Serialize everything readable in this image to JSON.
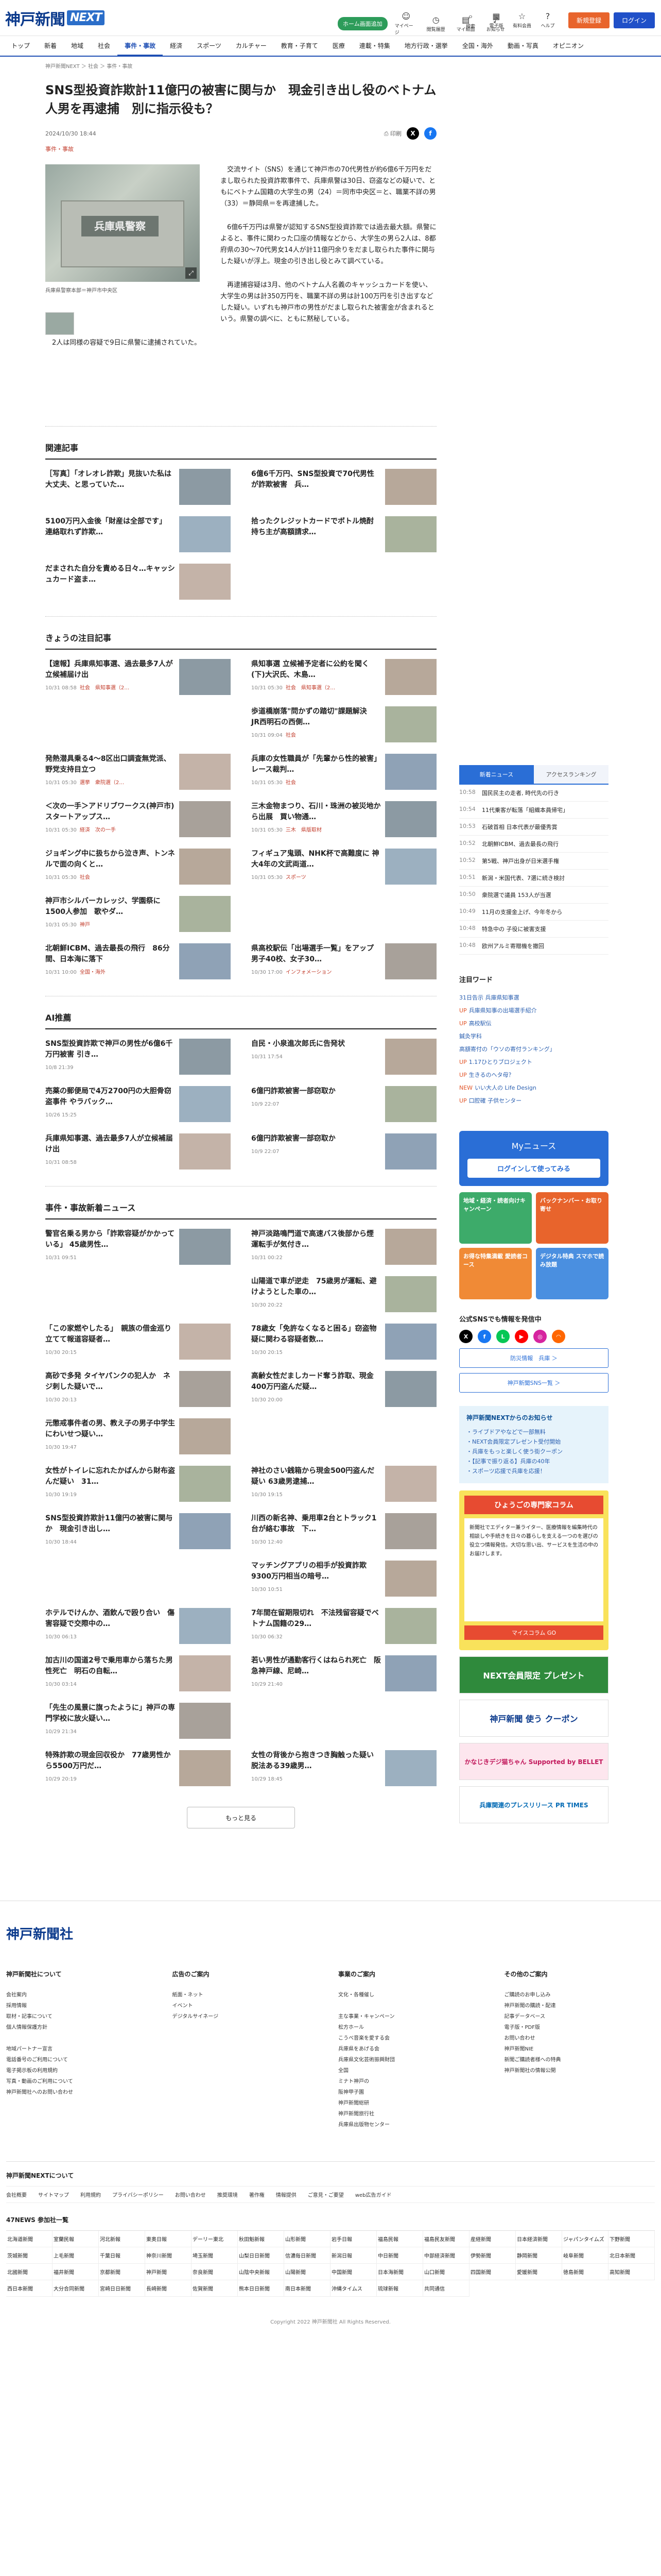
{
  "header": {
    "logo_text": "神戸新聞",
    "logo_next": "NEXT",
    "pill": "ホーム画面追加",
    "icons": [
      "マイページ",
      "閲覧履歴",
      "マイ紙面",
      "お知らせ"
    ],
    "icons2": [
      "検索",
      "電子版",
      "有料会員",
      "ヘルプ"
    ],
    "signup": "新規登録",
    "login": "ログイン"
  },
  "gnav": [
    "トップ",
    "新着",
    "地域",
    "社会",
    "事件・事故",
    "経済",
    "スポーツ",
    "カルチャー",
    "教育・子育て",
    "医療",
    "連載・特集",
    "地方行政・選挙",
    "全国・海外",
    "動画・写真",
    "オピニオン"
  ],
  "gnav_active": 4,
  "breadcrumb": "神戸新聞NEXT ＞ 社会 ＞ 事件・事故",
  "article": {
    "title": "SNS型投資詐欺計11億円の被害に関与か　現金引き出し役のベトナム人男を再逮捕　別に指示役も？",
    "date": "2024/10/30 18:44",
    "print": "印刷",
    "category": "事件・事故",
    "photo_sign": "兵庫県警察",
    "caption": "兵庫県警察本部＝神戸市中央区",
    "paragraphs": [
      "交流サイト（SNS）を通じて神戸市の70代男性が約6億6千万円をだまし取られた投資詐欺事件で、兵庫県警は30日、窃盗などの疑いで、ともにベトナム国籍の大学生の男（24）＝同市中央区＝と、職業不詳の男（33）＝静岡県＝を再逮捕した。",
      "6億6千万円は県警が認知するSNS型投資詐欺では過去最大額。県警によると、事件に関わった口座の情報などから、大学生の男ら2人は、8都府県の30～70代男女14人が計11億円余りをだまし取られた事件に関与した疑いが浮上。現金の引き出し役とみて調べている。",
      "再逮捕容疑は3月、他のベトナム人名義のキャッシュカードを使い、大学生の男は計350万円を、職業不詳の男は計100万円を引き出すなどした疑い。いずれも神戸市の男性がだまし取られた被害金が含まれるという。県警の調べに、ともに黙秘している。",
      "2人は同様の容疑で9日に県警に逮捕されていた。"
    ]
  },
  "related": {
    "heading": "関連記事",
    "items": [
      {
        "title": "［写真］「オレオレ詐欺」見抜いた私は大丈夫、と思っていた…"
      },
      {
        "title": "6億6千万円、SNS型投資で70代男性が詐欺被害　兵…"
      },
      {
        "title": "5100万円入金後「財産は全部です」　連絡取れず詐欺…"
      },
      {
        "title": "拾ったクレジットカードでボトル焼酎　持ち主が高額請求…"
      },
      {
        "title": "だまされた自分を責める日々…キャッシュカード盗ま…"
      }
    ]
  },
  "today": {
    "heading": "きょうの注目記事",
    "items": [
      {
        "title": "【速報】兵庫県知事選、過去最多7人が立候補届け出",
        "date": "10/31 08:58",
        "tag": "社会　県知事選（2…"
      },
      {
        "title": "県知事選 立候補予定者に公約を聞く(下)大沢氏、木島…",
        "date": "10/31 05:30",
        "tag": "社会　県知事選（2…"
      },
      {
        "title": "",
        "date": "",
        "tag": ""
      },
      {
        "title": "歩道橋崩落\"問かずの踏切\"課題解決　JR西明石の西側…",
        "date": "10/31 09:04",
        "tag": "社会"
      },
      {
        "title": "発熱潜具乗る4～8区出口調査無党派、野党支持目立つ",
        "date": "10/31 05:30",
        "tag": "選挙　衆院選（2…"
      },
      {
        "title": "兵庫の女性職員が「先輩から性的被害」レース裁判…",
        "date": "10/31 05:30",
        "tag": "社会"
      },
      {
        "title": "＜次の一手＞アドリブワークス(神戸市)スタートアップス…",
        "date": "10/31 05:30",
        "tag": "経済　次の一手"
      },
      {
        "title": "三木金物まつり、石川・珠洲の被災地から出展　買い物通…",
        "date": "10/31 05:30",
        "tag": "三木　県版取材"
      },
      {
        "title": "ジョギング中に扱ちから泣き声、トンネルで面の向くと…",
        "date": "10/31 05:30",
        "tag": "社会"
      },
      {
        "title": "フィギュア鬼頭、NHK杯で高難度に 神大4年の文武両道…",
        "date": "10/31 05:30",
        "tag": "スポーツ"
      },
      {
        "title": "神戸市シルバーカレッジ、学園祭に1500人参加　歌やダ…",
        "date": "10/31 05:30",
        "tag": "神戸"
      },
      {
        "title": "",
        "date": "",
        "tag": ""
      },
      {
        "title": "北朝鮮ICBM、過去最長の飛行　86分間、日本海に落下",
        "date": "10/31 10:00",
        "tag": "全国・海外"
      },
      {
        "title": "県高校駅伝「出場選手一覧」をアップ 男子40校、女子30…",
        "date": "10/30 17:00",
        "tag": "インフォメーション"
      }
    ]
  },
  "ai": {
    "heading": "AI推薦",
    "items": [
      {
        "title": "SNS型投資詐欺で神戸の男性が6億6千万円被害 引き…",
        "date": "10/8 21:39"
      },
      {
        "title": "自民・小泉進次郎氏に告発状",
        "date": "10/31 17:54"
      },
      {
        "title": "売薬の郵便局で4万2700円の大胆骨窃盗事件 やラバック…",
        "date": "10/26 15:25"
      },
      {
        "title": "6億円詐欺被害一部窃取か",
        "date": "10/9 22:07"
      },
      {
        "title": "兵庫県知事選、過去最多7人が立候補届け出",
        "date": "10/31 08:58"
      },
      {
        "title": "6億円詐欺被害一部窃取か",
        "date": "10/9 22:07"
      }
    ]
  },
  "crime": {
    "heading": "事件・事故新着ニュース",
    "items": [
      {
        "title": "警官名乗る男から「詐欺容疑がかかっている」 45歳男性…",
        "date": "10/31 09:51"
      },
      {
        "title": "神戸淡路鳴門道で高速バス後部から煙　運転手が気付き…",
        "date": "10/31 00:22"
      },
      {
        "title": "",
        "date": ""
      },
      {
        "title": "山陽道で車が逆走　75歳男が運転、避けようとした車の…",
        "date": "10/30 20:22"
      },
      {
        "title": "「この家燃やしたる」　親族の借金巡り立てて報道容疑者…",
        "date": "10/30 20:15"
      },
      {
        "title": "78歳女「免許なくなると困る」窃盗物疑に関わる容疑者数…",
        "date": "10/30 20:15"
      },
      {
        "title": "高砂で多発 タイヤパンクの犯人か　ネジ刺した疑いで…",
        "date": "10/30 20:13"
      },
      {
        "title": "高齢女性だましカード奪う詐取、現金400万円盗んだ疑…",
        "date": "10/30 20:00"
      },
      {
        "title": "元懲戒事件者の男、教え子の男子中学生にわいせつ疑い…",
        "date": "10/30 19:47"
      },
      {
        "title": "",
        "date": ""
      },
      {
        "title": "女性がトイレに忘れたかばんから財布盗んだ疑い　31…",
        "date": "10/30 19:19"
      },
      {
        "title": "神社のさい銭箱から現金500円盗んだ疑い 63歳男逮捕…",
        "date": "10/30 19:15"
      },
      {
        "title": "SNS型投資詐欺計11億円の被害に関与か　現金引き出し…",
        "date": "10/30 18:44"
      },
      {
        "title": "川西の新名神、乗用車2台とトラック1台が絡む事故　下…",
        "date": "10/30 12:40"
      },
      {
        "title": "",
        "date": ""
      },
      {
        "title": "マッチングアプリの相手が投資詐欺　9300万円相当の暗号…",
        "date": "10/30 10:51"
      },
      {
        "title": "ホテルでけんか、酒飲んで殴り合い　傷害容疑で交際中の…",
        "date": "10/30 06:13"
      },
      {
        "title": "7年間在留期限切れ　不法残留容疑でベトナム国籍の29…",
        "date": "10/30 06:32"
      },
      {
        "title": "加古川の国道2号で乗用車から落ちた男性死亡　明石の自転…",
        "date": "10/30 03:14"
      },
      {
        "title": "若い男性が通勤客行くはねられ死亡　阪急神戸線、尼崎…",
        "date": "10/29 21:40"
      },
      {
        "title": "「先生の風景に旗ったように」神戸の専門学校に放火疑い…",
        "date": "10/29 21:34"
      },
      {
        "title": "",
        "date": ""
      },
      {
        "title": "特殊詐欺の現金回収役か　77歳男性から5500万円だ…",
        "date": "10/29 20:19"
      },
      {
        "title": "女性の背後から抱きつき胸触った疑い 脱法ある39歳男…",
        "date": "10/29 18:45"
      }
    ],
    "more": "もっと見る"
  },
  "side": {
    "tabs": [
      "新着ニュース",
      "アクセスランキング"
    ],
    "rank": [
      {
        "t": "10:58",
        "s": "国民民主の走者, 時代先の行き"
      },
      {
        "t": "10:54",
        "s": "11代乗客が転落「組織本員帰宅」"
      },
      {
        "t": "10:53",
        "s": "石破首相 日本代表が最優秀賞"
      },
      {
        "t": "10:52",
        "s": "北朝鮮ICBM、過去最長の飛行"
      },
      {
        "t": "10:52",
        "s": "第5戦、神戸出身が日米選手権"
      },
      {
        "t": "10:51",
        "s": "新潟・米国代表、7選に続き検討"
      },
      {
        "t": "10:50",
        "s": "衆院選で議員 153人が当選"
      },
      {
        "t": "10:49",
        "s": "11月の支援金上げ、今年冬から"
      },
      {
        "t": "10:48",
        "s": "特急中の 子役に被害支援"
      },
      {
        "t": "10:48",
        "s": "欧州アルミ寄贈機を撤回"
      }
    ],
    "kw_heading": "注目ワード",
    "kw": [
      {
        "up": "",
        "w": "31日告示 兵庫県知事選"
      },
      {
        "up": "UP",
        "w": "兵庫県知事の出場選手紹介"
      },
      {
        "up": "UP",
        "w": "高校駅伝"
      },
      {
        "up": "",
        "w": "鍼灸学科"
      },
      {
        "up": "",
        "w": "高額寄付の「ウソの寄付ランキング」"
      },
      {
        "up": "UP",
        "w": "1.17ひとりブロジェクト"
      },
      {
        "up": "UP",
        "w": "生きるのヘタ母？"
      },
      {
        "up": "NEW",
        "w": "いい大人の Life Design"
      },
      {
        "up": "UP",
        "w": "口腔確 子供センター"
      }
    ],
    "mynews_title": "Myニュース",
    "mynews_btn": "ログインして使ってみる",
    "tiles": [
      "地域・経済・読者向けキャンペーン",
      "バックナンバー・お取り寄せ",
      "お得な特集満載 愛読者コース",
      "デジタル特典 スマホで読み放題"
    ],
    "sns_heading": "公式SNSでも情報を発信中",
    "sns_btns": [
      "防災情報　兵庫 ＞",
      "神戸新聞SNS一覧 ＞"
    ],
    "info_heading": "神戸新聞NEXTからのお知らせ",
    "info": [
      "・ライブドアやなどで一部無料",
      "・NEXT会員限定プレゼント受付開始",
      "・兵庫をもっと楽しく使う街クーポン",
      "・【記事で振り返る】兵庫の40年",
      "・スポーツ応援で兵庫を応援！"
    ],
    "ad_head": "ひょうごの専門家コラム",
    "ad_body": "新聞社でエディター兼ライター、医療情報を編集時代の相談しや手続きを日々の暮らしを支える一つのを選びの役立つ情報発信。大切な思い出、サービスを生活の中のお届けします。",
    "ad_foot": "マイスコラム GO",
    "banners": [
      "NEXT会員限定 プレゼント",
      "神戸新聞 使う クーポン",
      "かなじきデジ猫ちゃん Supported by BELLET",
      "兵庫関連のプレスリリース PR TIMES"
    ]
  },
  "footer": {
    "logo": "神戸新聞社",
    "cols": [
      {
        "h": "神戸新聞社について",
        "items": [
          "会社案内",
          "採用情報",
          "取材・記事について",
          "個人情報保護方針",
          "",
          "地域パートナー宣言",
          "電話番号のご利用について",
          "電子掲示板の利用規約",
          "写真・動画のご利用について",
          "神戸新聞社へのお問い合わせ"
        ]
      },
      {
        "h": "広告のご案内",
        "items": [
          "紙面・ネット",
          "イベント",
          "デジタルサイネージ"
        ]
      },
      {
        "h": "事業のご案内",
        "items": [
          "文化・各種催し",
          "",
          "主な事業・キャンペーン",
          "松方ホール",
          "こうべ音楽を愛する会",
          "兵庫県をあげる会",
          "兵庫県文化芸術振興財団",
          "全国",
          "ミナト神戸の",
          "阪神甲子園",
          "神戸新聞総研",
          "神戸新聞旅行社",
          "兵庫県出版物センター"
        ]
      },
      {
        "h": "その他のご案内",
        "items": [
          "ご購読のお申し込み",
          "神戸新聞の購読・配達",
          "記事データベース",
          "電子版・PDF版",
          "お問い合わせ",
          "神戸新聞NIE",
          "新聞ご購読者様への特典",
          "神戸新聞社の情報公開"
        ]
      }
    ],
    "nav_heading": "神戸新聞NEXTについて",
    "nav": [
      "会社概要",
      "サイトマップ",
      "利用規約",
      "プライバシーポリシー",
      "お問い合わせ",
      "推奨環境",
      "著作権",
      "情報提供",
      "ご意見・ご要望",
      "web広告ガイド"
    ],
    "n47_heading": "47NEWS 参加社一覧",
    "n47": [
      "北海道新聞",
      "室蘭民報",
      "河北新報",
      "東奥日報",
      "デーリー東北",
      "秋田魁新報",
      "山形新聞",
      "岩手日報",
      "福島民報",
      "福島民友新聞",
      "産経新聞",
      "日本経済新聞",
      "ジャパンタイムズ",
      "下野新聞",
      "茨城新聞",
      "上毛新聞",
      "千葉日報",
      "神奈川新聞",
      "埼玉新聞",
      "山梨日日新聞",
      "信濃毎日新聞",
      "新潟日報",
      "中日新聞",
      "中部経済新聞",
      "伊勢新聞",
      "静岡新聞",
      "岐阜新聞",
      "北日本新聞",
      "北國新聞",
      "福井新聞",
      "京都新聞",
      "神戸新聞",
      "奈良新聞",
      "山陰中央新報",
      "山陽新聞",
      "中国新聞",
      "日本海新聞",
      "山口新聞",
      "四国新聞",
      "愛媛新聞",
      "徳島新聞",
      "高知新聞",
      "西日本新聞",
      "大分合同新聞",
      "宮崎日日新聞",
      "長崎新聞",
      "佐賀新聞",
      "熊本日日新聞",
      "南日本新聞",
      "沖縄タイムス",
      "琉球新報",
      "共同通信"
    ],
    "copyright": "Copyright 2022 神戸新聞社 All Rights Reserved."
  }
}
